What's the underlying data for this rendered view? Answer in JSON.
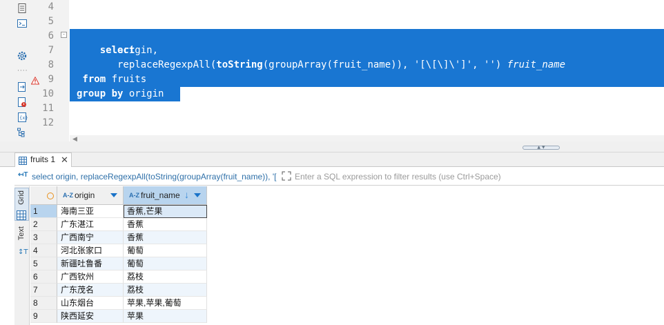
{
  "editor": {
    "line_numbers": [
      "4",
      "5",
      "6",
      "7",
      "8",
      "9",
      "10",
      "11",
      "12"
    ],
    "lines": {
      "l6_kw": "select",
      "l7_text": "       origin,",
      "l8_func": "       replaceRegexpAll(",
      "l8_kw": "toString",
      "l8_rest": "(groupArray(fruit_name)), '[\\[\\]\\']', '') ",
      "l8_alias": "fruit_name",
      "l9_kw": " from",
      "l9_rest": " fruits",
      "l10_kw": "group by",
      "l10_rest": " origin"
    },
    "fold_marker": "-",
    "colors": {
      "selection": "#1976d2"
    }
  },
  "results_tab": {
    "label": "fruits 1",
    "close": "✕"
  },
  "filter": {
    "icon": "↤T",
    "query": "select origin, replaceRegexpAll(toString(groupArray(fruit_name)), '[",
    "placeholder": "Enter a SQL expression to filter results (use Ctrl+Space)"
  },
  "side_tabs": {
    "grid": "Grid",
    "text": "Text"
  },
  "grid": {
    "columns": [
      {
        "type": "A-Z",
        "name": "origin"
      },
      {
        "type": "A-Z",
        "name": "fruit_name",
        "sort": "↓"
      }
    ],
    "rows": [
      {
        "num": "1",
        "origin": "海南三亚",
        "fruit_name": "香蕉,芒果"
      },
      {
        "num": "2",
        "origin": "广东湛江",
        "fruit_name": "香蕉"
      },
      {
        "num": "3",
        "origin": "广西南宁",
        "fruit_name": "香蕉"
      },
      {
        "num": "4",
        "origin": "河北张家口",
        "fruit_name": "葡萄"
      },
      {
        "num": "5",
        "origin": "新疆吐鲁番",
        "fruit_name": "葡萄"
      },
      {
        "num": "6",
        "origin": "广西钦州",
        "fruit_name": "荔枝"
      },
      {
        "num": "7",
        "origin": "广东茂名",
        "fruit_name": "荔枝"
      },
      {
        "num": "8",
        "origin": "山东烟台",
        "fruit_name": "苹果,苹果,葡萄"
      },
      {
        "num": "9",
        "origin": "陕西延安",
        "fruit_name": "苹果"
      }
    ]
  },
  "icons": {
    "toolbar": [
      "document-icon",
      "console-icon",
      "settings-gear-icon",
      "more-dots-icon",
      "export-icon",
      "error-file-icon",
      "variables-icon",
      "outline-icon"
    ],
    "warning": "warning-icon",
    "tab": "grid-table-icon"
  }
}
